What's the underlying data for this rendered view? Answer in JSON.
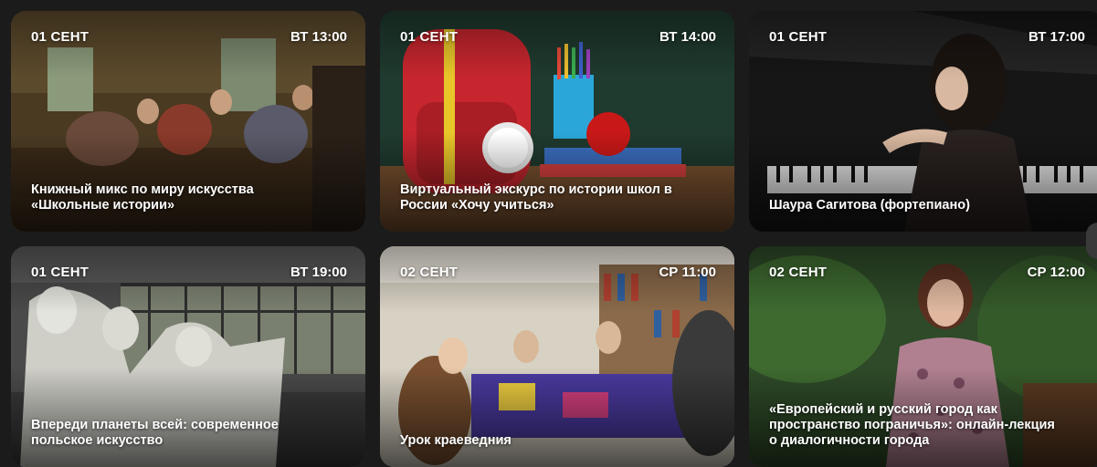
{
  "events": [
    {
      "date": "01 СЕНТ",
      "time": "ВТ 13:00",
      "title": "Книжный микс по миру искусства\n«Школьные истории»",
      "image": "classroom-painting"
    },
    {
      "date": "01 СЕНТ",
      "time": "ВТ 14:00",
      "title": "Виртуальный экскурс по истории школ в\nРоссии «Хочу учиться»",
      "image": "school-backpack"
    },
    {
      "date": "01 СЕНТ",
      "time": "ВТ 17:00",
      "title": "Шаура Сагитова (фортепиано)",
      "image": "pianist"
    },
    {
      "date": "01 СЕНТ",
      "time": "ВТ 19:00",
      "title": "Впереди планеты всей: современное\nпольское искусство",
      "image": "sculpture-hall"
    },
    {
      "date": "02 СЕНТ",
      "time": "СР 11:00",
      "title": "Урок краеведния",
      "image": "library-group"
    },
    {
      "date": "02 СЕНТ",
      "time": "СР 12:00",
      "title": "«Европейский и русский город как\nпространство пограничья»: онлайн-лекция\nо диалогичности города",
      "image": "woman-garden"
    }
  ]
}
